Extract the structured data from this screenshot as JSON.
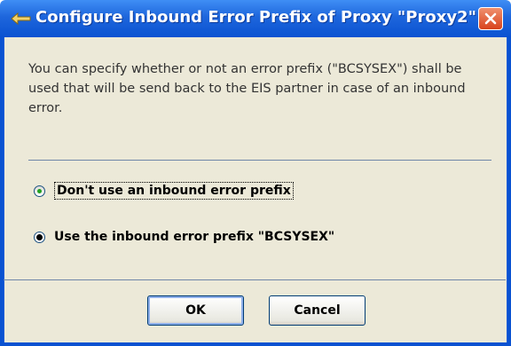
{
  "dialog": {
    "title": "Configure Inbound Error Prefix of Proxy \"Proxy2\"",
    "description": "You can specify whether or not an error prefix (\"BCSYSEX\") shall be used that will be send back to the EIS partner in case of an inbound error.",
    "options": [
      {
        "label": "Don't use an inbound error prefix",
        "selected": false
      },
      {
        "label": "Use the inbound error prefix \"BCSYSEX\"",
        "selected": true
      }
    ],
    "ok_label": "OK",
    "cancel_label": "Cancel"
  },
  "icons": {
    "title": "app-icon",
    "close": "close-icon"
  },
  "colors": {
    "titlebar": "#0a52d1",
    "close_button": "#d8431c",
    "body": "#ece9d8"
  }
}
